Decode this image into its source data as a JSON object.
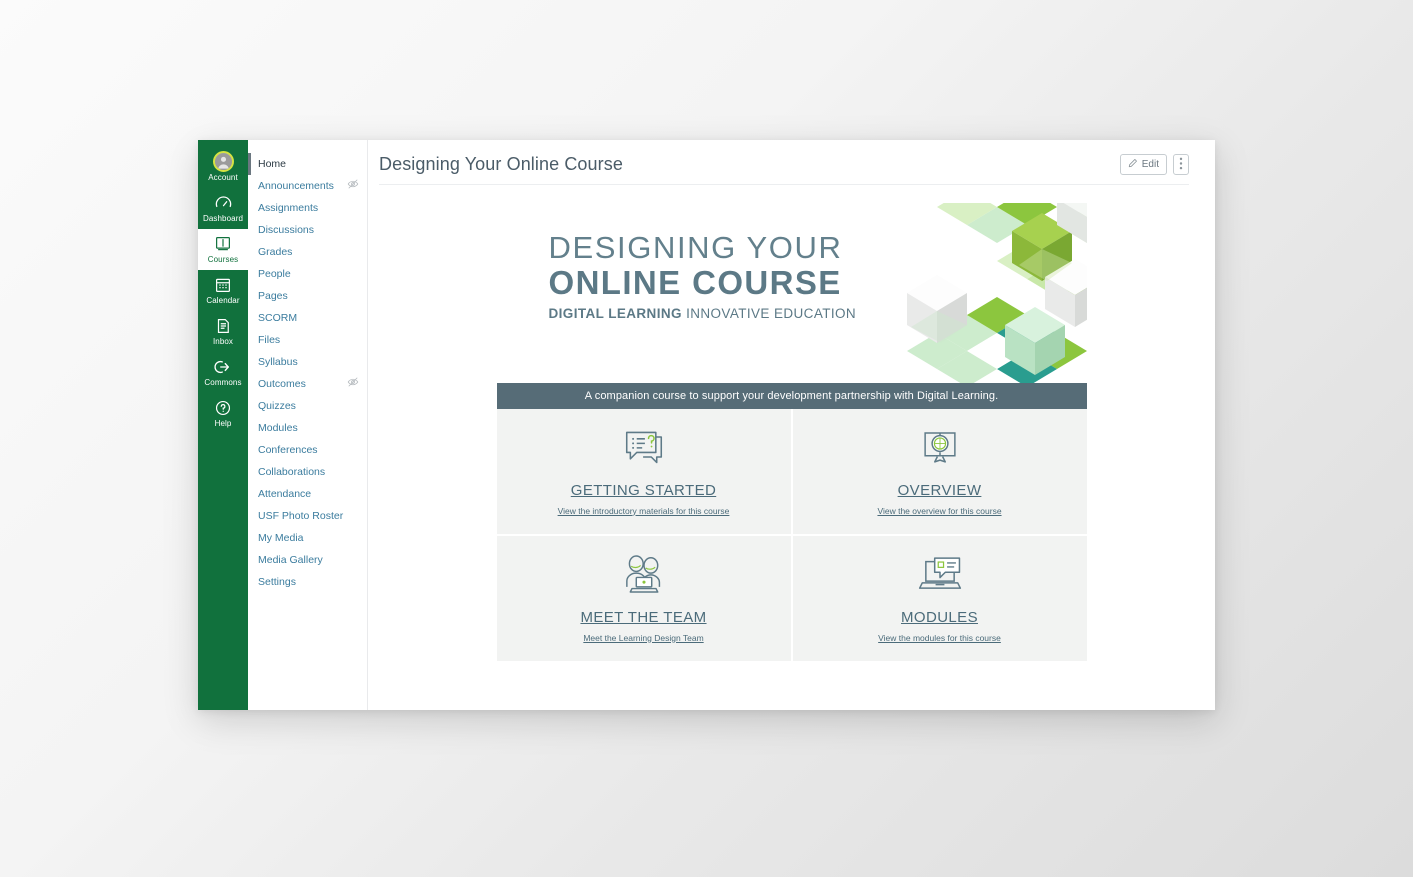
{
  "global_nav": {
    "items": [
      {
        "label": "Account",
        "icon": "user-avatar-icon",
        "active": false
      },
      {
        "label": "Dashboard",
        "icon": "dashboard-icon",
        "active": false
      },
      {
        "label": "Courses",
        "icon": "courses-book-icon",
        "active": true
      },
      {
        "label": "Calendar",
        "icon": "calendar-icon",
        "active": false
      },
      {
        "label": "Inbox",
        "icon": "inbox-icon",
        "active": false
      },
      {
        "label": "Commons",
        "icon": "commons-arrow-icon",
        "active": false
      },
      {
        "label": "Help",
        "icon": "help-question-icon",
        "active": false
      }
    ]
  },
  "course_nav": {
    "items": [
      {
        "label": "Home",
        "active": true,
        "hidden_icon": false
      },
      {
        "label": "Announcements",
        "active": false,
        "hidden_icon": true
      },
      {
        "label": "Assignments",
        "active": false,
        "hidden_icon": false
      },
      {
        "label": "Discussions",
        "active": false,
        "hidden_icon": false
      },
      {
        "label": "Grades",
        "active": false,
        "hidden_icon": false
      },
      {
        "label": "People",
        "active": false,
        "hidden_icon": false
      },
      {
        "label": "Pages",
        "active": false,
        "hidden_icon": false
      },
      {
        "label": "SCORM",
        "active": false,
        "hidden_icon": false
      },
      {
        "label": "Files",
        "active": false,
        "hidden_icon": false
      },
      {
        "label": "Syllabus",
        "active": false,
        "hidden_icon": false
      },
      {
        "label": "Outcomes",
        "active": false,
        "hidden_icon": true
      },
      {
        "label": "Quizzes",
        "active": false,
        "hidden_icon": false
      },
      {
        "label": "Modules",
        "active": false,
        "hidden_icon": false
      },
      {
        "label": "Conferences",
        "active": false,
        "hidden_icon": false
      },
      {
        "label": "Collaborations",
        "active": false,
        "hidden_icon": false
      },
      {
        "label": "Attendance",
        "active": false,
        "hidden_icon": false
      },
      {
        "label": "USF Photo Roster",
        "active": false,
        "hidden_icon": false
      },
      {
        "label": "My Media",
        "active": false,
        "hidden_icon": false
      },
      {
        "label": "Media Gallery",
        "active": false,
        "hidden_icon": false
      },
      {
        "label": "Settings",
        "active": false,
        "hidden_icon": false
      }
    ]
  },
  "header": {
    "title": "Designing Your Online Course",
    "edit_label": "Edit",
    "edit_icon": "pencil-icon",
    "more_icon": "kebab-menu-icon"
  },
  "banner": {
    "line1": "DESIGNING YOUR",
    "line2": "ONLINE COURSE",
    "line3_bold": "DIGITAL LEARNING",
    "line3_light": "INNOVATIVE EDUCATION",
    "subtitle": "A companion course to support your development partnership with Digital Learning.",
    "graphic": "isometric-cubes-graphic"
  },
  "tiles": [
    {
      "title": "GETTING STARTED",
      "subtitle": "View the introductory materials for this course",
      "icon": "speech-bubble-question-icon"
    },
    {
      "title": "OVERVIEW",
      "subtitle": "View the overview for this course",
      "icon": "globe-badge-icon"
    },
    {
      "title": "MEET THE TEAM",
      "subtitle": "Meet the Learning Design Team",
      "icon": "two-people-laptop-icon"
    },
    {
      "title": "MODULES",
      "subtitle": "View the modules for this course",
      "icon": "laptop-speech-bubble-icon"
    }
  ],
  "colors": {
    "global_nav_green": "#11713d",
    "link_blue": "#3b7c9e",
    "banner_slate": "#5c7986",
    "subtitle_bar": "#566c77",
    "tile_bg": "#f2f3f2",
    "accent_lime": "#8cc63e",
    "avatar_ring": "#d6e342"
  }
}
